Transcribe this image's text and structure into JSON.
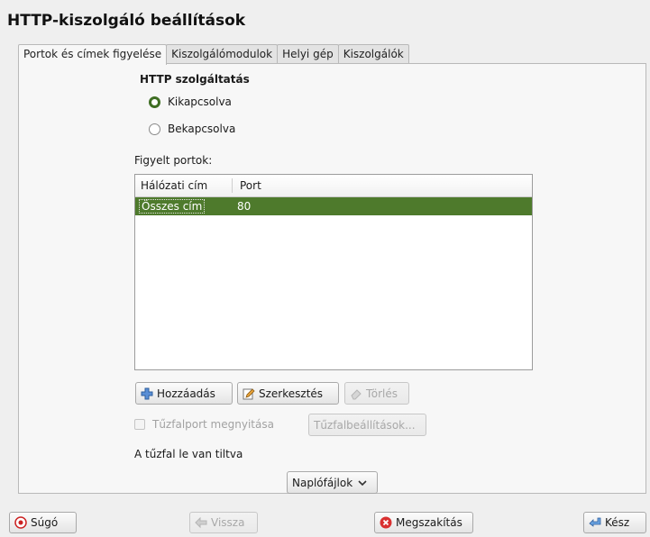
{
  "window": {
    "title": "HTTP-kiszolgáló beállítások"
  },
  "tabs": [
    {
      "label": "Portok és címek figyelése",
      "active": true
    },
    {
      "label": "Kiszolgálómodulok",
      "active": false
    },
    {
      "label": "Helyi gép",
      "active": false
    },
    {
      "label": "Kiszolgálók",
      "active": false
    }
  ],
  "service": {
    "title": "HTTP szolgáltatás",
    "options": [
      {
        "label": "Kikapcsolva",
        "checked": true
      },
      {
        "label": "Bekapcsolva",
        "checked": false
      }
    ]
  },
  "ports": {
    "label": "Figyelt portok:",
    "columns": [
      "Hálózati cím",
      "Port"
    ],
    "rows": [
      {
        "address": "Összes cím",
        "port": "80",
        "selected": true
      }
    ]
  },
  "buttons": {
    "add": "Hozzáadás",
    "edit": "Szerkesztés",
    "delete": "Törlés"
  },
  "firewall": {
    "open_port_label": "Tűzfalport megnyitása",
    "settings_label": "Tűzfalbeállítások...",
    "status": "A tűzfal le van tiltva"
  },
  "logs_button": "Naplófájlok",
  "footer": {
    "help": "Súgó",
    "back": "Vissza",
    "cancel": "Megszakítás",
    "finish": "Kész"
  },
  "colors": {
    "selection": "#4e7a2c",
    "radio_checked": "#3f6e23",
    "cancel_icon": "#d93030"
  }
}
